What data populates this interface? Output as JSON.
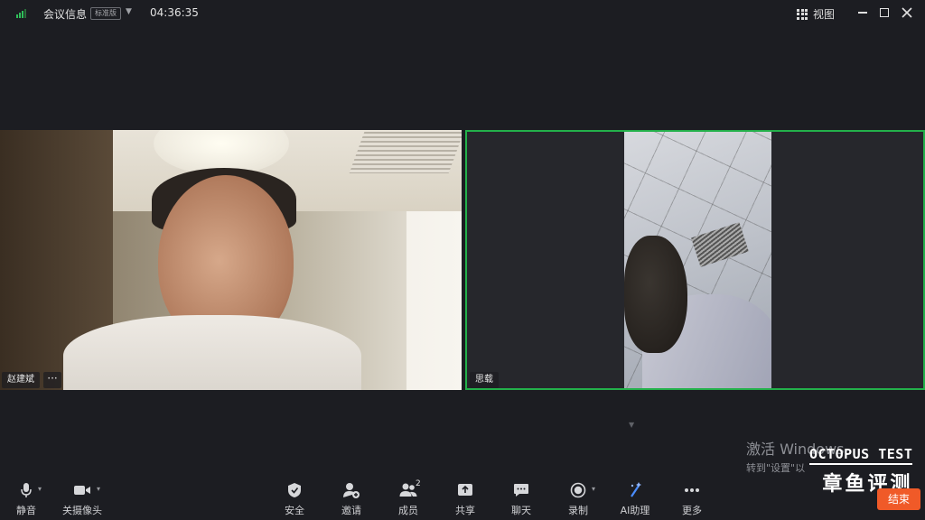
{
  "topbar": {
    "meeting_title": "会议信息",
    "edition_badge": "标准版",
    "timer": "04:36:35",
    "view_label": "视图"
  },
  "participants": [
    {
      "name": "赵建斌",
      "more": "···"
    },
    {
      "name": "思载"
    }
  ],
  "watermark": {
    "activate_line1": "激活 Windows",
    "activate_line2": "转到\"设置\"以",
    "brand_en": "OCTOPUS TEST",
    "brand_cn": "章鱼评测"
  },
  "toolbar": {
    "mute": "静音",
    "camera": "关摄像头",
    "security": "安全",
    "invite": "邀请",
    "members": "成员",
    "member_count": "2",
    "share": "共享",
    "chat": "聊天",
    "record": "录制",
    "ai": "AI助理",
    "more": "更多",
    "end": "结束"
  },
  "colors": {
    "background": "#1c1d22",
    "active_speaker_border": "#23b04a",
    "signal": "#2fbf5a",
    "end_button": "#f05a28"
  }
}
